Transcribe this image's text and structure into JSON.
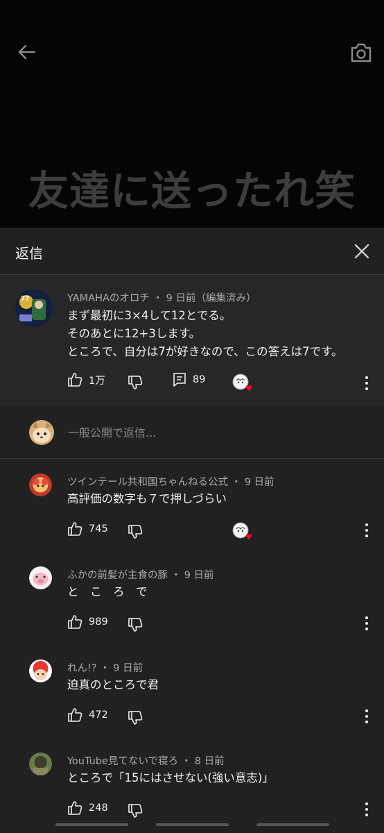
{
  "video": {
    "overlay_text": "友達に送ったれ笑"
  },
  "header": {
    "title": "返信"
  },
  "parent_comment": {
    "author": "YAMAHAのオロチ",
    "time": "9 日前（編集済み）",
    "lines": [
      "まず最初に3×4して12とでる。",
      "そのあとに12+3します。",
      "ところで、自分は7が好きなので、この答えは7です。"
    ],
    "likes": "1万",
    "replies": "89"
  },
  "reply_input": {
    "placeholder": "一般公開で返信..."
  },
  "comments": [
    {
      "author": "ツインテール共和国ちゃんねる公式",
      "time": "9 日前",
      "text": "高評価の数字も７で押しづらい",
      "likes": "745",
      "creator_heart": true
    },
    {
      "author": "ふかの前髪が主食の豚",
      "time": "9 日前",
      "text": "と　こ　ろ　で",
      "likes": "989",
      "creator_heart": false
    },
    {
      "author": "れん!?",
      "time": "9 日前",
      "text": "迫真のところで君",
      "likes": "472",
      "creator_heart": false
    },
    {
      "author": "YouTube見てないで寝ろ",
      "time": "8 日前",
      "text": "ところで「15にはさせない(強い意志)」",
      "likes": "248",
      "creator_heart": false
    }
  ],
  "colors": {
    "background": "#212121",
    "parent_background": "#272727",
    "text_primary": "#f1f1f1",
    "text_secondary": "#aaaaaa",
    "heart": "#ff0033"
  }
}
